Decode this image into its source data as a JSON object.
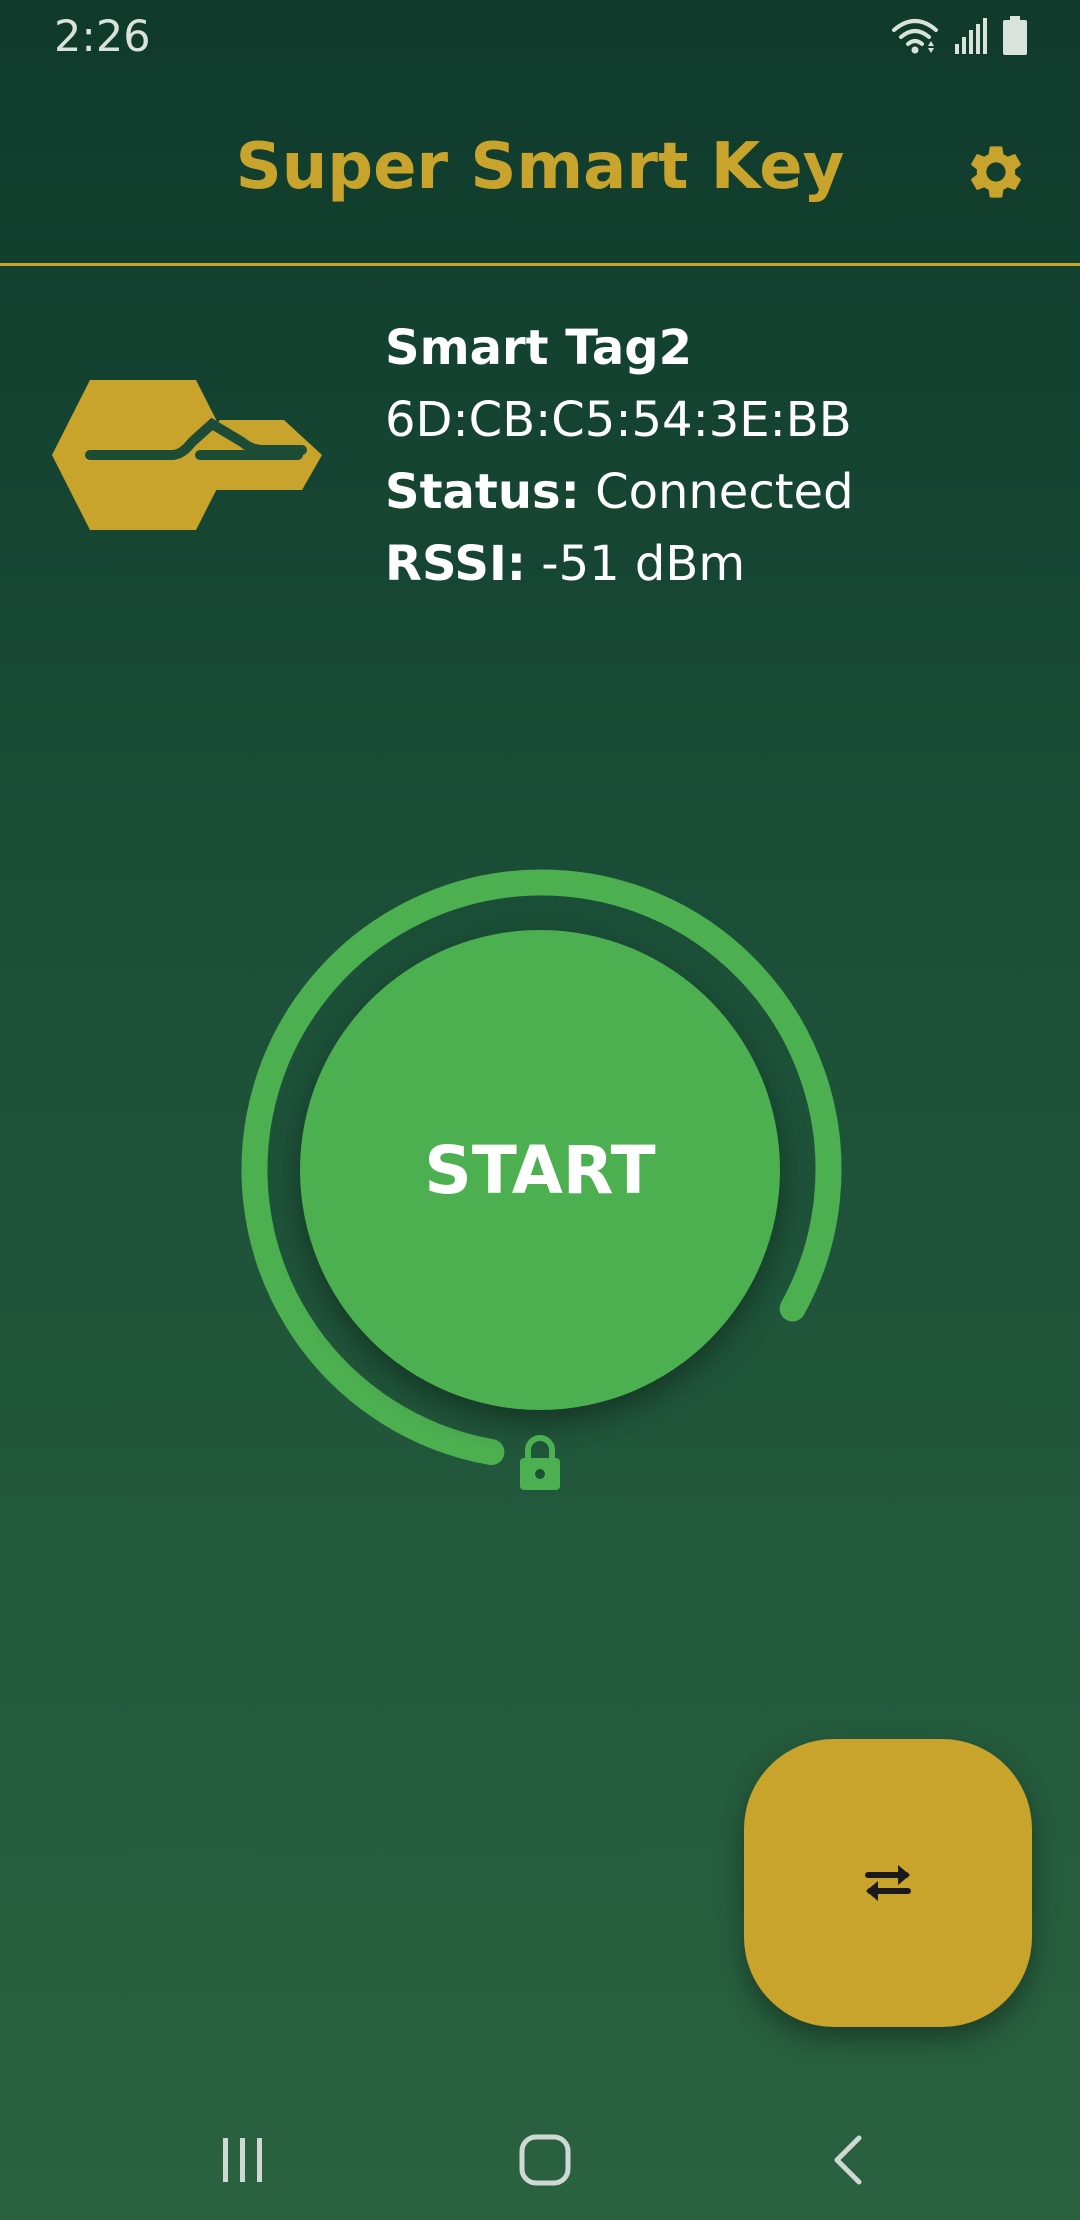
{
  "status_bar": {
    "time": "2:26",
    "icons": [
      "wifi-icon",
      "signal-icon",
      "battery-icon"
    ]
  },
  "app_bar": {
    "title": "Super Smart Key",
    "settings_icon": "gear-icon"
  },
  "device": {
    "name": "Smart Tag2",
    "mac": "6D:CB:C5:54:3E:BB",
    "status_label": "Status:",
    "status_value": "Connected",
    "rssi_label": "RSSI:",
    "rssi_value": "-51 dBm"
  },
  "main": {
    "start_label": "START",
    "lock_icon": "lock-icon"
  },
  "fab": {
    "icon": "swap-arrows-icon"
  },
  "nav_bar": {
    "items": [
      "recent-apps-icon",
      "home-icon",
      "back-icon"
    ]
  },
  "colors": {
    "accent": "#c9a42c",
    "primary_green": "#4caf50",
    "background_top": "#0f3a2c",
    "background_bottom": "#2a6240"
  }
}
